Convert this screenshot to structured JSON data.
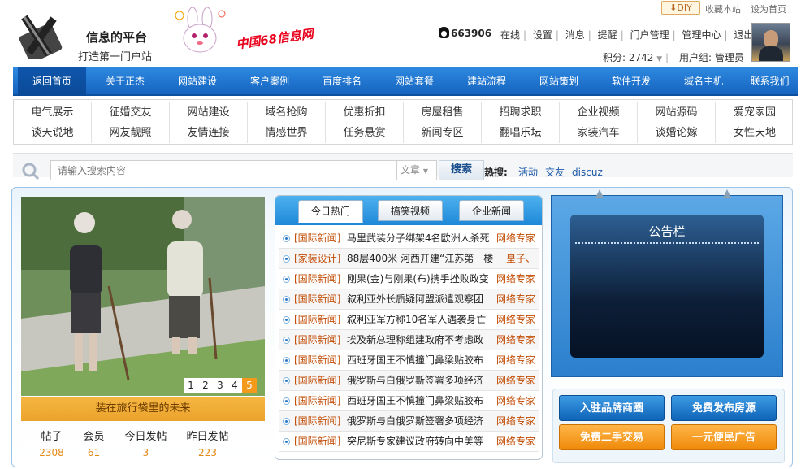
{
  "header": {
    "logo": {
      "slogan_main": "信息的平台",
      "slogan_sub": "打造第一门户站",
      "brand": "中国68信息网"
    },
    "top_links": {
      "diy": "DIY",
      "favorite": "收藏本站",
      "set_home": "设为首页"
    },
    "qq_number": "663906",
    "user_menu": [
      "在线",
      "设置",
      "消息",
      "提醒",
      "门户管理",
      "管理中心",
      "退出"
    ],
    "credits": "积分: 2742",
    "user_group": "用户组: 管理员"
  },
  "nav": {
    "items": [
      "返回首页",
      "关于正杰",
      "网站建设",
      "客户案例",
      "百度排名",
      "网站套餐",
      "建站流程",
      "网站策划",
      "软件开发",
      "域名主机",
      "联系我们"
    ],
    "active_index": 0
  },
  "categories": [
    [
      "电气展示",
      "谈天说地"
    ],
    [
      "征婚交友",
      "网友靓照"
    ],
    [
      "网站建设",
      "友情连接"
    ],
    [
      "域名抢购",
      "情感世界"
    ],
    [
      "优惠折扣",
      "任务悬赏"
    ],
    [
      "房屋租售",
      "新闻专区"
    ],
    [
      "招聘求职",
      "翻唱乐坛"
    ],
    [
      "企业视频",
      "家装汽车"
    ],
    [
      "网站源码",
      "谈婚论嫁"
    ],
    [
      "爱宠家园",
      "女性天地"
    ]
  ],
  "search": {
    "placeholder": "请输入搜索内容",
    "type": "文章",
    "button": "搜索",
    "hot_label": "热搜:",
    "hot_links": [
      "活动",
      "交友",
      "discuz"
    ]
  },
  "slideshow": {
    "caption": "装在旅行袋里的未来",
    "pages": [
      "1",
      "2",
      "3",
      "4",
      "5"
    ],
    "active_page": 4
  },
  "stats": [
    {
      "label": "帖子",
      "value": "2308"
    },
    {
      "label": "会员",
      "value": "61"
    },
    {
      "label": "今日发帖",
      "value": "3"
    },
    {
      "label": "昨日发帖",
      "value": "223"
    }
  ],
  "news": {
    "tabs": [
      "今日热门",
      "搞笑视频",
      "企业新闻"
    ],
    "active_tab": 0,
    "rows": [
      {
        "category": "[国际新闻]",
        "title": "马里武装分子绑架4名欧洲人杀死",
        "author": "网络专家"
      },
      {
        "category": "[家装设计]",
        "title": "88层400米 河西开建“江苏第一楼”",
        "author": "皇子、"
      },
      {
        "category": "[国际新闻]",
        "title": "刚果(金)与刚果(布)携手挫败政变",
        "author": "网络专家"
      },
      {
        "category": "[国际新闻]",
        "title": "叙利亚外长质疑阿盟派遣观察团",
        "author": "网络专家"
      },
      {
        "category": "[国际新闻]",
        "title": "叙利亚军方称10名军人遇袭身亡",
        "author": "网络专家"
      },
      {
        "category": "[国际新闻]",
        "title": "埃及新总理称组建政府不考虑政",
        "author": "网络专家"
      },
      {
        "category": "[国际新闻]",
        "title": "西班牙国王不慎撞门鼻梁贴胶布",
        "author": "网络专家"
      },
      {
        "category": "[国际新闻]",
        "title": "俄罗斯与白俄罗斯签署多项经济",
        "author": "网络专家"
      },
      {
        "category": "[国际新闻]",
        "title": "西班牙国王不慎撞门鼻梁贴胶布",
        "author": "网络专家"
      },
      {
        "category": "[国际新闻]",
        "title": "俄罗斯与白俄罗斯签署多项经济",
        "author": "网络专家"
      },
      {
        "category": "[国际新闻]",
        "title": "突尼斯专家建议政府转向中美等",
        "author": "网络专家"
      }
    ]
  },
  "notice": {
    "title": "公告栏"
  },
  "actions": [
    "入驻品牌商圈",
    "免费发布房源",
    "免费二手交易",
    "一元便民广告"
  ],
  "colors": {
    "nav_blue": "#1f78d1",
    "accent_orange": "#f39a1b",
    "news_red": "#c24c05"
  }
}
